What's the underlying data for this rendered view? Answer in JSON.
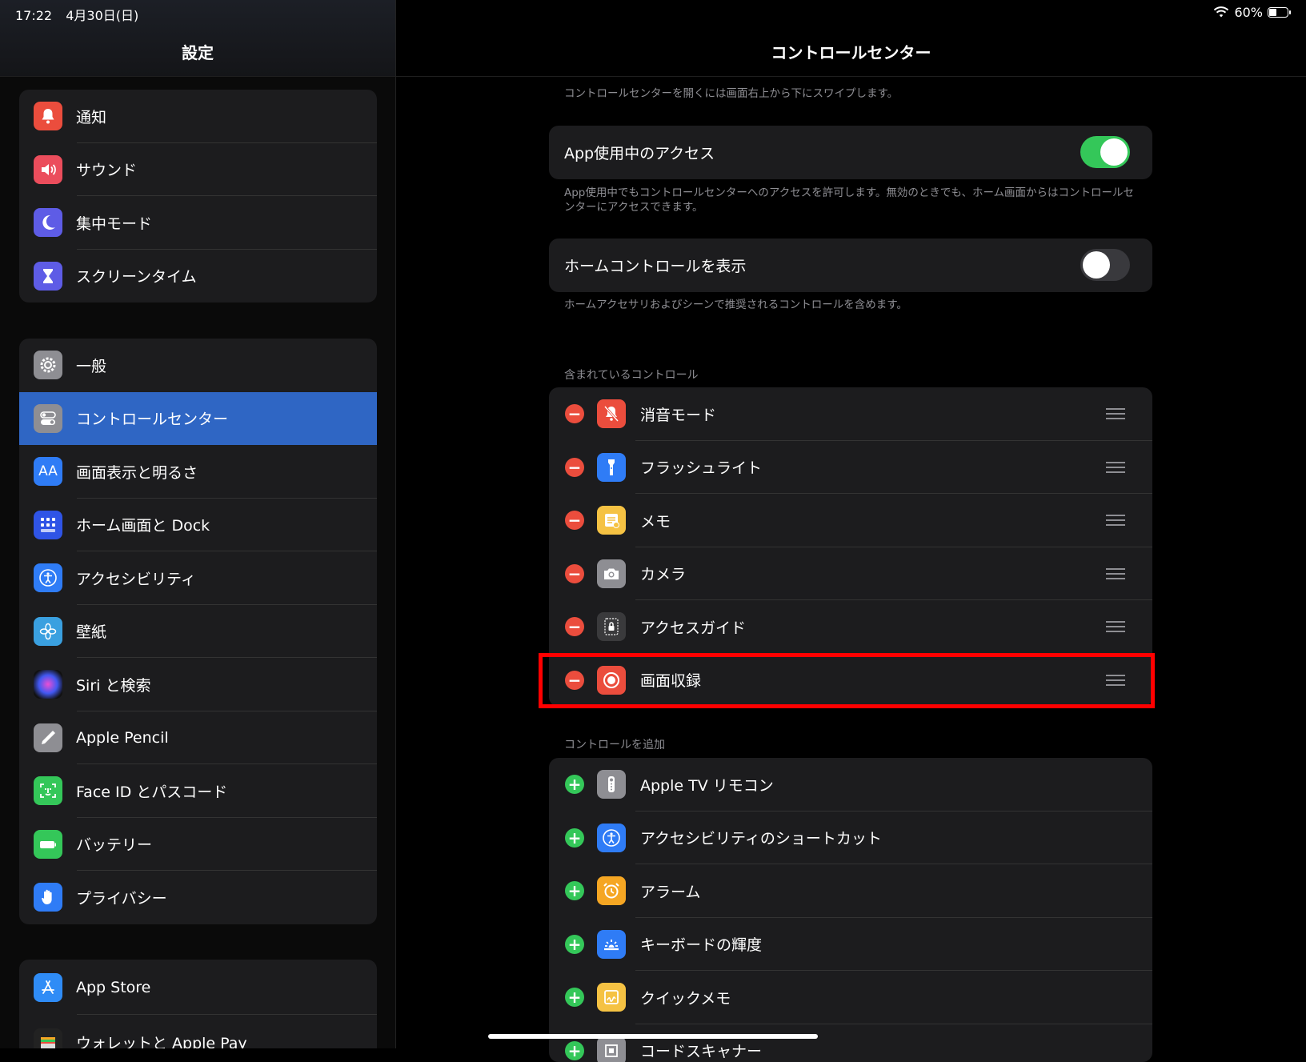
{
  "status": {
    "time": "17:22",
    "date": "4月30日(日)",
    "battery": "60%"
  },
  "sidebar": {
    "title": "設定",
    "groups": [
      {
        "items": [
          {
            "label": "通知",
            "icon": "bell-icon",
            "color": "#eb4d3d"
          },
          {
            "label": "サウンド",
            "icon": "speaker-icon",
            "color": "#eb4d5c"
          },
          {
            "label": "集中モード",
            "icon": "moon-icon",
            "color": "#5e5ce6"
          },
          {
            "label": "スクリーンタイム",
            "icon": "hourglass-icon",
            "color": "#5e5ce6"
          }
        ]
      },
      {
        "items": [
          {
            "label": "一般",
            "icon": "gear-icon",
            "color": "#8e8e93"
          },
          {
            "label": "コントロールセンター",
            "icon": "switches-icon",
            "color": "#8e8e93",
            "selected": true
          },
          {
            "label": "画面表示と明るさ",
            "icon": "text-size-icon",
            "color": "#2f7cf6"
          },
          {
            "label": "ホーム画面と Dock",
            "icon": "app-grid-icon",
            "color": "#2f54e6"
          },
          {
            "label": "アクセシビリティ",
            "icon": "accessibility-icon",
            "color": "#2f7cf6"
          },
          {
            "label": "壁紙",
            "icon": "flower-icon",
            "color": "#3aa0e0"
          },
          {
            "label": "Siri と検索",
            "icon": "siri-icon",
            "color": "#222"
          },
          {
            "label": "Apple Pencil",
            "icon": "pencil-icon",
            "color": "#8e8e93"
          },
          {
            "label": "Face ID とパスコード",
            "icon": "face-id-icon",
            "color": "#34c759"
          },
          {
            "label": "バッテリー",
            "icon": "battery-icon",
            "color": "#34c759"
          },
          {
            "label": "プライバシー",
            "icon": "hand-icon",
            "color": "#2f7cf6"
          }
        ]
      },
      {
        "items": [
          {
            "label": "App Store",
            "icon": "app-store-icon",
            "color": "#2f8cf6"
          },
          {
            "label": "ウォレットと Apple Pay",
            "icon": "wallet-icon",
            "color": "#222"
          }
        ]
      }
    ]
  },
  "main": {
    "title": "コントロールセンター",
    "intro": "コントロールセンターを開くには画面右上から下にスワイプします。",
    "access_in_apps": {
      "label": "App使用中のアクセス",
      "on": true,
      "footer": "App使用中でもコントロールセンターへのアクセスを許可します。無効のときでも、ホーム画面からはコントロールセンターにアクセスできます。"
    },
    "home_controls": {
      "label": "ホームコントロールを表示",
      "on": false,
      "footer": "ホームアクセサリおよびシーンで推奨されるコントロールを含めます。"
    },
    "included_header": "含まれているコントロール",
    "included": [
      {
        "label": "消音モード",
        "icon": "bell-slash-icon",
        "color": "#eb4d3d"
      },
      {
        "label": "フラッシュライト",
        "icon": "flashlight-icon",
        "color": "#2f7cf6"
      },
      {
        "label": "メモ",
        "icon": "notes-icon",
        "color": "#f5c243"
      },
      {
        "label": "カメラ",
        "icon": "camera-icon",
        "color": "#8e8e93"
      },
      {
        "label": "アクセスガイド",
        "icon": "lock-icon",
        "color": "#3a3a3c"
      },
      {
        "label": "画面収録",
        "icon": "record-icon",
        "color": "#eb4d3d"
      }
    ],
    "more_header": "コントロールを追加",
    "more": [
      {
        "label": "Apple TV リモコン",
        "icon": "remote-icon",
        "color": "#8e8e93"
      },
      {
        "label": "アクセシビリティのショートカット",
        "icon": "accessibility-icon",
        "color": "#2f7cf6"
      },
      {
        "label": "アラーム",
        "icon": "alarm-icon",
        "color": "#f5a623"
      },
      {
        "label": "キーボードの輝度",
        "icon": "keyboard-brightness-icon",
        "color": "#2f7cf6"
      },
      {
        "label": "クイックメモ",
        "icon": "quick-note-icon",
        "color": "#f5c243"
      },
      {
        "label": "コードスキャナー",
        "icon": "code-scanner-icon",
        "color": "#8e8e93"
      }
    ]
  }
}
